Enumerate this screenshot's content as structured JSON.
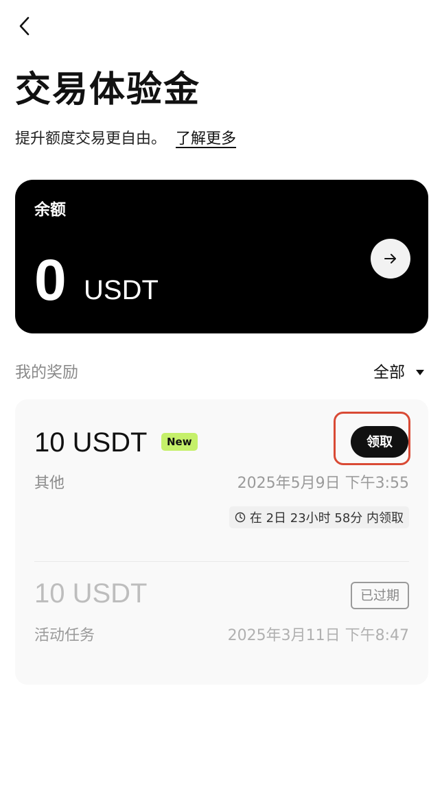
{
  "header": {
    "back_icon": "chevron-left-icon",
    "title": "交易体验金",
    "subtitle": "提升额度交易更自由。",
    "learn_more": "了解更多"
  },
  "balance": {
    "label": "余额",
    "amount": "0",
    "unit": "USDT",
    "arrow_icon": "arrow-right-icon"
  },
  "rewards": {
    "title": "我的奖励",
    "filter": "全部",
    "items": [
      {
        "amount": "10 USDT",
        "badge": "New",
        "action": "领取",
        "source": "其他",
        "date": "2025年5月9日 下午3:55",
        "deadline": "在 2日 23小时 58分 内领取"
      },
      {
        "amount": "10 USDT",
        "status": "已过期",
        "source": "活动任务",
        "date": "2025年3月11日 下午8:47"
      }
    ]
  },
  "colors": {
    "card_bg": "#000000",
    "new_badge": "#c5f06a",
    "highlight": "#d94a35",
    "reward_card_bg": "#f9f9f9"
  }
}
